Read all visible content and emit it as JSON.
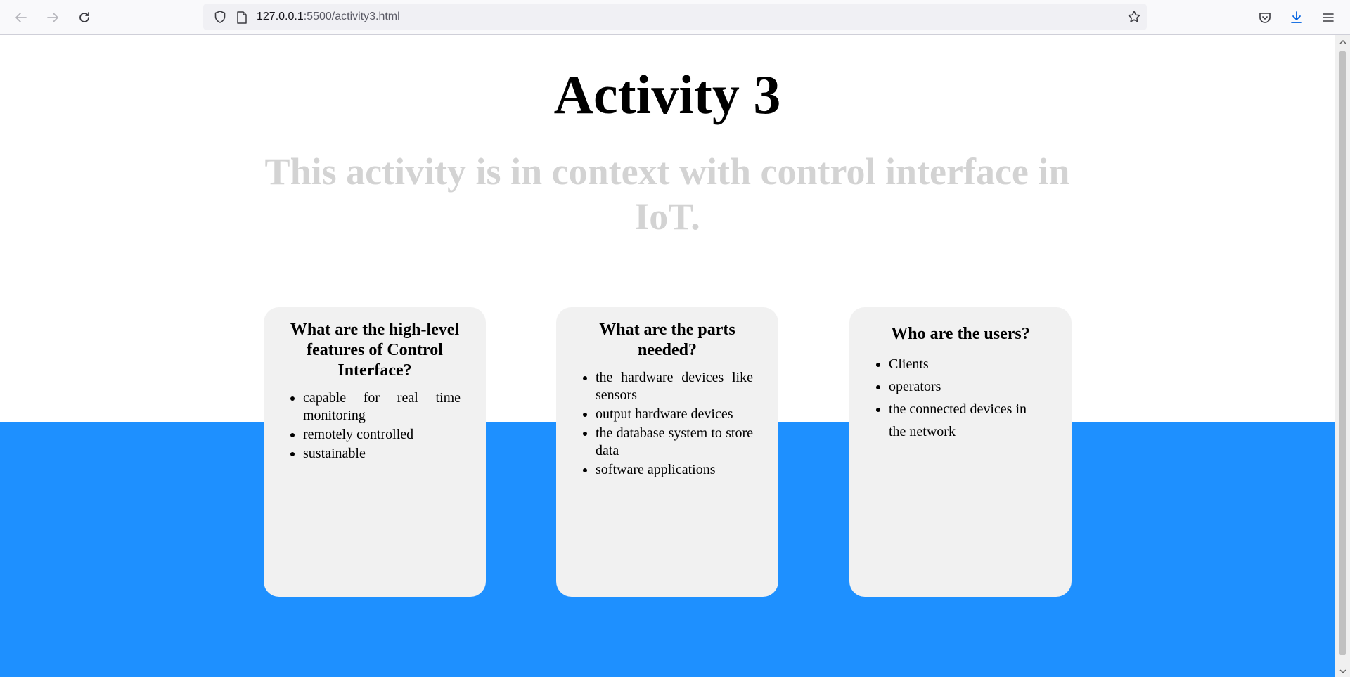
{
  "browser": {
    "url_host": "127.0.0.1",
    "url_path": ":5500/activity3.html",
    "icons": {
      "back": "arrow-left-icon",
      "forward": "arrow-right-icon",
      "reload": "reload-icon",
      "site_info": "shield-icon",
      "page": "page-icon",
      "bookmark": "star-icon",
      "pocket": "pocket-icon",
      "downloads": "download-icon",
      "menu": "hamburger-menu-icon"
    }
  },
  "page": {
    "title": "Activity 3",
    "subtitle": "This activity is in context with control interface in IoT.",
    "colors": {
      "band": "#1e90ff",
      "card": "#f1f1f1",
      "subtitle": "#d3d3d3"
    },
    "cards": [
      {
        "heading": "What are the high-level features of Control Interface?",
        "items": [
          "capable for real time monitoring",
          "remotely controlled",
          "sustainable"
        ]
      },
      {
        "heading": "What are the parts needed?",
        "items": [
          "the hardware devices like sensors",
          "output hardware devices",
          "the database system to store data",
          "software applications"
        ]
      },
      {
        "heading": "Who are the users?",
        "items": [
          "Clients",
          "operators",
          "the connected devices in the network"
        ]
      }
    ]
  }
}
